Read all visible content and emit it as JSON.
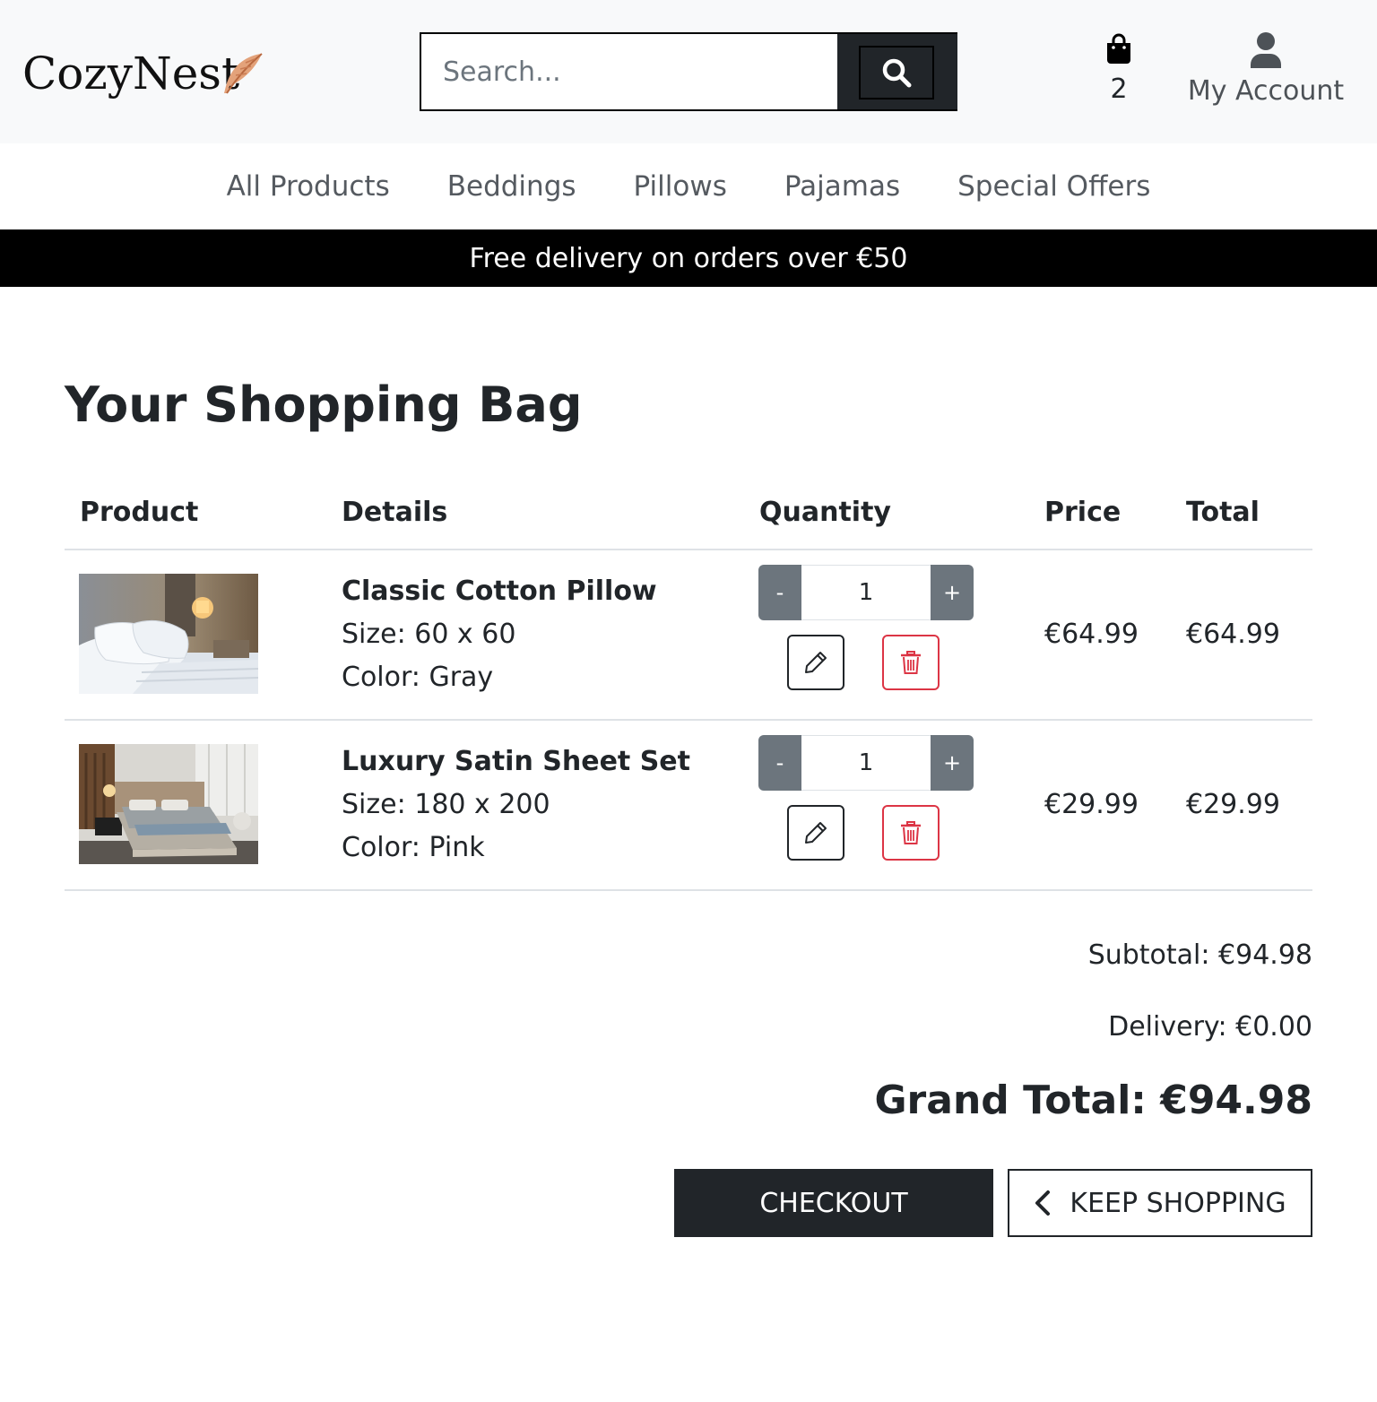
{
  "brand": {
    "name": "CozyNest",
    "icon": "feather-icon"
  },
  "search": {
    "placeholder": "Search...",
    "icon": "search-icon"
  },
  "bag": {
    "icon": "shopping-bag-icon",
    "count": "2"
  },
  "account": {
    "icon": "user-icon",
    "label": "My Account"
  },
  "nav": [
    "All Products",
    "Beddings",
    "Pillows",
    "Pajamas",
    "Special Offers"
  ],
  "banner": "Free delivery on orders over €50",
  "page_title": "Your Shopping Bag",
  "table": {
    "headers": [
      "Product",
      "Details",
      "Quantity",
      "Price",
      "Total"
    ],
    "rows": [
      {
        "name": "Classic Cotton Pillow",
        "size": "Size: 60 x 60",
        "color": "Color: Gray",
        "quantity": "1",
        "price": "€64.99",
        "total": "€64.99"
      },
      {
        "name": "Luxury Satin Sheet Set",
        "size": "Size: 180 x 200",
        "color": "Color: Pink",
        "quantity": "1",
        "price": "€29.99",
        "total": "€29.99"
      }
    ],
    "qty_minus": "-",
    "qty_plus": "+"
  },
  "summary": {
    "subtotal": "Subtotal: €94.98",
    "delivery": "Delivery: €0.00",
    "grand_total": "Grand Total: €94.98"
  },
  "actions": {
    "checkout": "CHECKOUT",
    "keep_shopping": "KEEP SHOPPING"
  },
  "colors": {
    "dark": "#212529",
    "header_bg": "#f8f9fa",
    "danger": "#dc3545",
    "qty_btn": "#6c757d",
    "feather": "#d98a5c"
  }
}
